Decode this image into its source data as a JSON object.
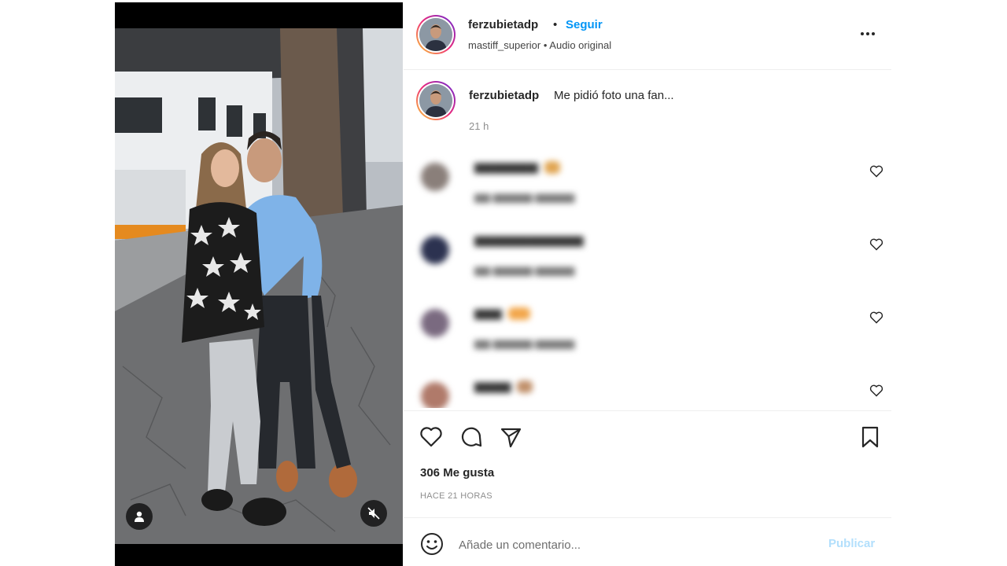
{
  "post": {
    "username": "ferzubietadp",
    "separator": "•",
    "follow_label": "Seguir",
    "audio_line": "mastiff_superior • Audio original",
    "more_icon": "more-horizontal-icon"
  },
  "caption": {
    "username": "ferzubietadp",
    "text": "Me pidió foto una fan...",
    "time": "21 h"
  },
  "actions": {
    "icons": [
      "heart-icon",
      "comment-icon",
      "share-icon",
      "bookmark-icon"
    ],
    "likes": "306 Me gusta",
    "posted": "HACE 21 HORAS"
  },
  "add_comment": {
    "placeholder": "Añade un comentario...",
    "publish_label": "Publicar"
  },
  "media": {
    "controls": [
      "user-tag-icon",
      "muted-speaker-icon"
    ]
  },
  "colors": {
    "accent": "#0095f6",
    "publish_disabled": "#b2dffc",
    "text": "#262626",
    "muted": "#8e8e8e"
  }
}
